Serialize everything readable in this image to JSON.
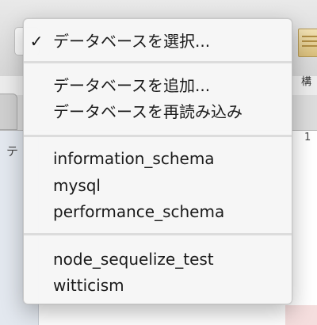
{
  "menu": {
    "selected_marker": "✓",
    "group1": [
      "データベースを選択..."
    ],
    "group2": [
      "データベースを追加...",
      "データベースを再読み込み"
    ],
    "group3": [
      "information_schema",
      "mysql",
      "performance_schema"
    ],
    "group4": [
      "node_sequelize_test",
      "witticism"
    ]
  },
  "background": {
    "struct_label": "構",
    "left_label": "テ",
    "right_label": "1"
  }
}
